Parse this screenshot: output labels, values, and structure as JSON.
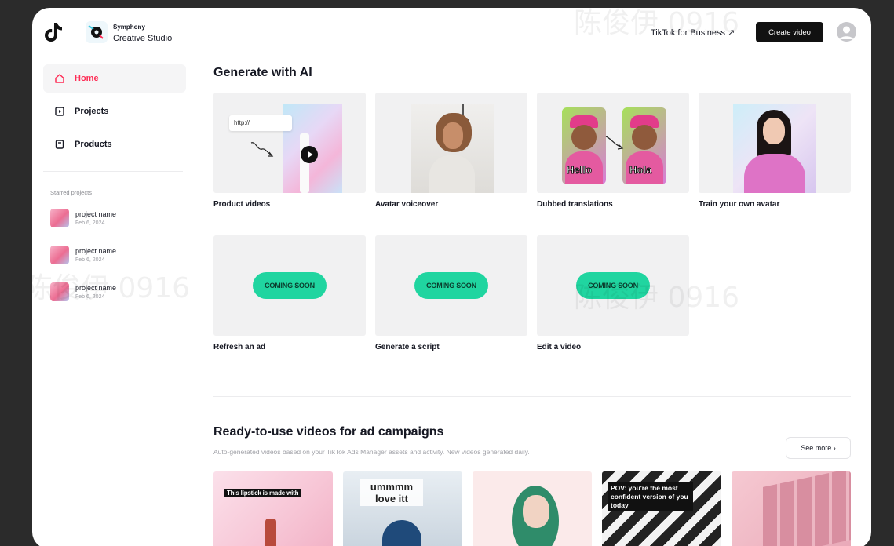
{
  "header": {
    "brand_line1": "Symphony",
    "brand_line2": "Creative Studio",
    "business_link": "TikTok for Business ↗",
    "create_button": "Create video"
  },
  "sidebar": {
    "nav": [
      {
        "label": "Home",
        "icon": "home-icon",
        "active": true
      },
      {
        "label": "Projects",
        "icon": "projects-icon"
      },
      {
        "label": "Products",
        "icon": "products-icon"
      }
    ],
    "starred_heading": "Starred projects",
    "starred": [
      {
        "name": "project name",
        "date": "Feb 6, 2024"
      },
      {
        "name": "project name",
        "date": "Feb 6, 2024"
      },
      {
        "name": "project name",
        "date": "Feb 6, 2024"
      }
    ]
  },
  "main": {
    "generate_heading": "Generate with AI",
    "cards": [
      {
        "label": "Product videos",
        "url_text": "http://"
      },
      {
        "label": "Avatar voiceover"
      },
      {
        "label": "Dubbed translations",
        "caption_a": "Hello",
        "caption_b": "Hola"
      },
      {
        "label": "Train your own avatar"
      },
      {
        "label": "Refresh an ad",
        "badge": "COMING SOON"
      },
      {
        "label": "Generate a script",
        "badge": "COMING SOON"
      },
      {
        "label": "Edit a video",
        "badge": "COMING SOON"
      }
    ],
    "ready_heading": "Ready-to-use videos for ad campaigns",
    "ready_subtitle": "Auto-generated videos based on your TikTok Ads Manager assets and activity. New videos generated daily.",
    "see_more": "See more  ›",
    "videos": [
      {
        "caption": "This lipstick is made with"
      },
      {
        "caption": "ummmm love itt"
      },
      {
        "caption": ""
      },
      {
        "caption": "POV: you're the most confident version of you today"
      },
      {
        "caption": ""
      }
    ]
  },
  "watermark": "陈俊伊 0916",
  "colors": {
    "accent": "#fe2c55",
    "coming_soon": "#20d5a0",
    "dark_button": "#111111"
  }
}
